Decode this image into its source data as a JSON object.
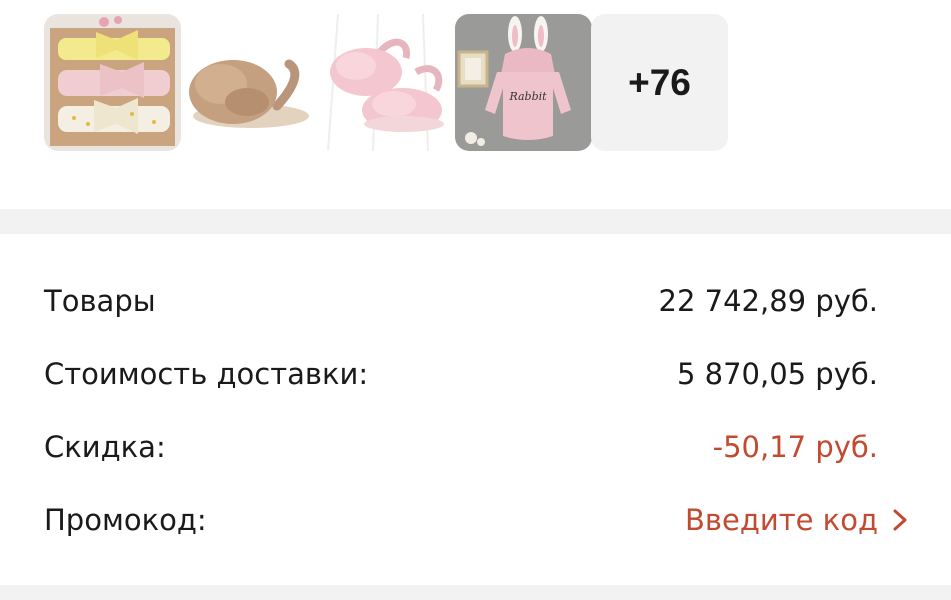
{
  "thumbnails": {
    "items": [
      {
        "icon": "headband-set-icon"
      },
      {
        "icon": "fur-sandal-beige-icon"
      },
      {
        "icon": "fur-sandals-pink-icon"
      },
      {
        "icon": "bunny-romper-icon"
      }
    ],
    "more_label": "+76"
  },
  "summary": {
    "goods_label": "Товары",
    "goods_value": "22 742,89 руб.",
    "delivery_label": "Стоимость доставки:",
    "delivery_value": "5 870,05 руб.",
    "discount_label": "Скидка:",
    "discount_value": "-50,17 руб.",
    "promo_label": "Промокод:",
    "promo_action": "Введите код"
  },
  "colors": {
    "accent": "#c24a30",
    "divider": "#f2f2f2",
    "text": "#1a1a1a"
  }
}
